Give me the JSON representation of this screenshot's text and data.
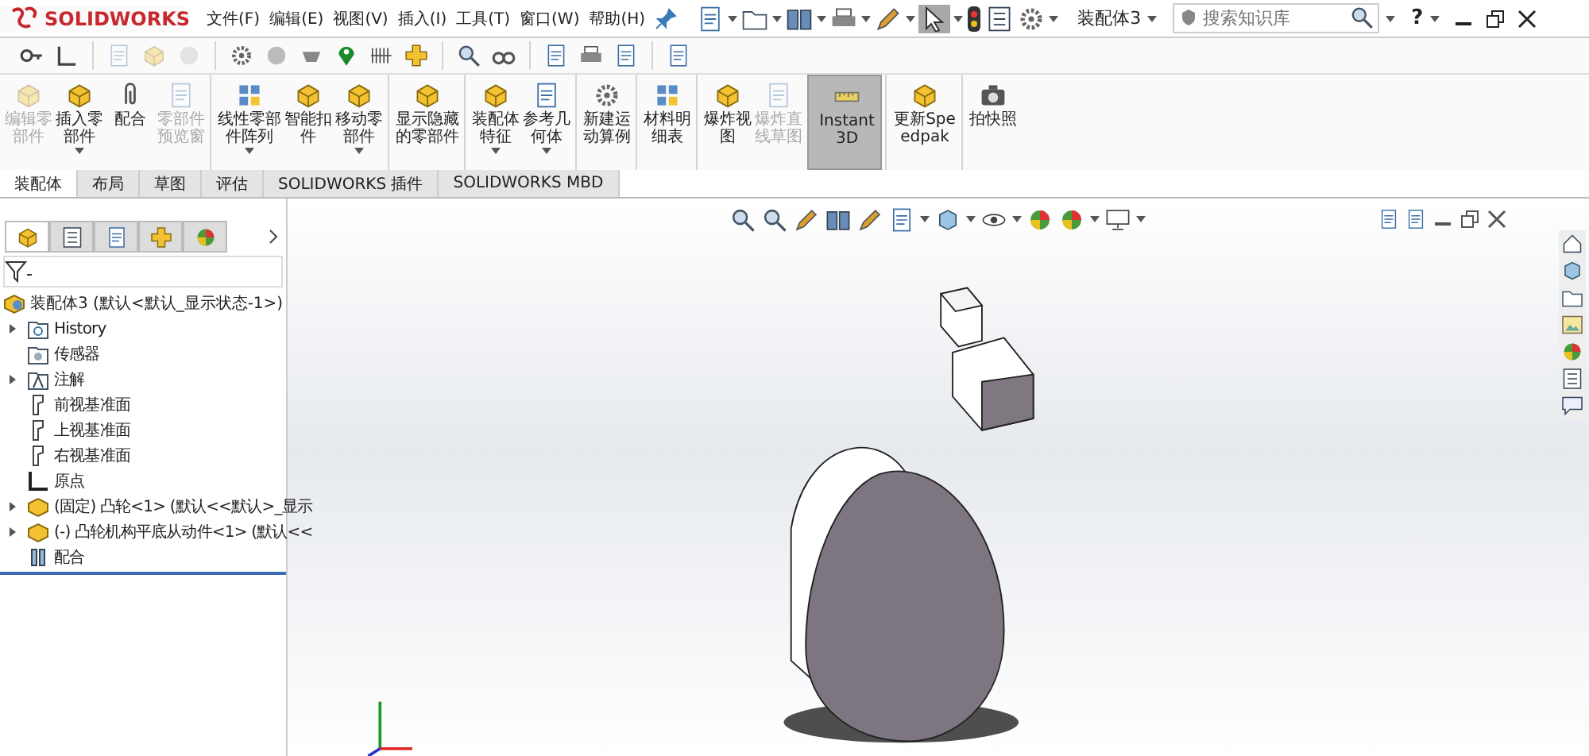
{
  "app": {
    "logo": "SOLIDWORKS",
    "document_title": "装配体3",
    "search": {
      "placeholder": "搜索知识库"
    },
    "help": "?"
  },
  "menu": [
    {
      "label": "文件(F)"
    },
    {
      "label": "编辑(E)"
    },
    {
      "label": "视图(V)"
    },
    {
      "label": "插入(I)"
    },
    {
      "label": "工具(T)"
    },
    {
      "label": "窗口(W)"
    },
    {
      "label": "帮助(H)"
    }
  ],
  "ribbon": [
    {
      "label": "编辑零部件",
      "disabled": true,
      "dropdown": false,
      "selected": false,
      "separator_before": false
    },
    {
      "label": "插入零部件",
      "disabled": false,
      "dropdown": true,
      "selected": false,
      "separator_before": false
    },
    {
      "label": "配合",
      "disabled": false,
      "dropdown": false,
      "selected": false,
      "separator_before": false
    },
    {
      "label": "零部件预览窗",
      "disabled": true,
      "dropdown": false,
      "selected": false,
      "separator_before": false
    },
    {
      "label": "线性零部件阵列",
      "disabled": false,
      "dropdown": true,
      "selected": false,
      "separator_before": true
    },
    {
      "label": "智能扣件",
      "disabled": false,
      "dropdown": false,
      "selected": false,
      "separator_before": false
    },
    {
      "label": "移动零部件",
      "disabled": false,
      "dropdown": true,
      "selected": false,
      "separator_before": false
    },
    {
      "label": "显示隐藏的零部件",
      "disabled": false,
      "dropdown": false,
      "selected": false,
      "separator_before": true
    },
    {
      "label": "装配体特征",
      "disabled": false,
      "dropdown": true,
      "selected": false,
      "separator_before": true
    },
    {
      "label": "参考几何体",
      "disabled": false,
      "dropdown": true,
      "selected": false,
      "separator_before": false
    },
    {
      "label": "新建运动算例",
      "disabled": false,
      "dropdown": false,
      "selected": false,
      "separator_before": true
    },
    {
      "label": "材料明细表",
      "disabled": false,
      "dropdown": false,
      "selected": false,
      "separator_before": true
    },
    {
      "label": "爆炸视图",
      "disabled": false,
      "dropdown": false,
      "selected": false,
      "separator_before": true
    },
    {
      "label": "爆炸直线草图",
      "disabled": true,
      "dropdown": false,
      "selected": false,
      "separator_before": false
    },
    {
      "label": "Instant3D",
      "disabled": false,
      "dropdown": false,
      "selected": true,
      "separator_before": true
    },
    {
      "label": "更新Speedpak",
      "disabled": false,
      "dropdown": false,
      "selected": false,
      "separator_before": true
    },
    {
      "label": "拍快照",
      "disabled": false,
      "dropdown": false,
      "selected": false,
      "separator_before": true
    }
  ],
  "tabs": [
    {
      "label": "装配体",
      "selected": true
    },
    {
      "label": "布局",
      "selected": false
    },
    {
      "label": "草图",
      "selected": false
    },
    {
      "label": "评估",
      "selected": false
    },
    {
      "label": "SOLIDWORKS 插件",
      "selected": false
    },
    {
      "label": "SOLIDWORKS MBD",
      "selected": false
    }
  ],
  "panel_tabs": [
    {
      "selected": true
    },
    {
      "selected": false
    },
    {
      "selected": false
    },
    {
      "selected": false
    },
    {
      "selected": false
    }
  ],
  "tree": {
    "label": "装配体3  (默认<默认_显示状态-1>)",
    "kind": "assembly",
    "children": [
      {
        "label": "History",
        "kind": "history",
        "collapsed": true
      },
      {
        "label": "传感器",
        "kind": "sensor",
        "collapsed": false
      },
      {
        "label": "注解",
        "kind": "annotation",
        "collapsed": true
      },
      {
        "label": "前视基准面",
        "kind": "plane",
        "collapsed": false
      },
      {
        "label": "上视基准面",
        "kind": "plane",
        "collapsed": false
      },
      {
        "label": "右视基准面",
        "kind": "plane",
        "collapsed": false
      },
      {
        "label": "原点",
        "kind": "origin",
        "collapsed": false
      },
      {
        "label": "(固定) 凸轮<1> (默认<<默认>_显示",
        "kind": "part",
        "collapsed": true
      },
      {
        "label": "(-) 凸轮机构平底从动件<1> (默认<<",
        "kind": "part",
        "collapsed": true
      },
      {
        "label": "配合",
        "kind": "mates",
        "collapsed": false
      }
    ]
  }
}
